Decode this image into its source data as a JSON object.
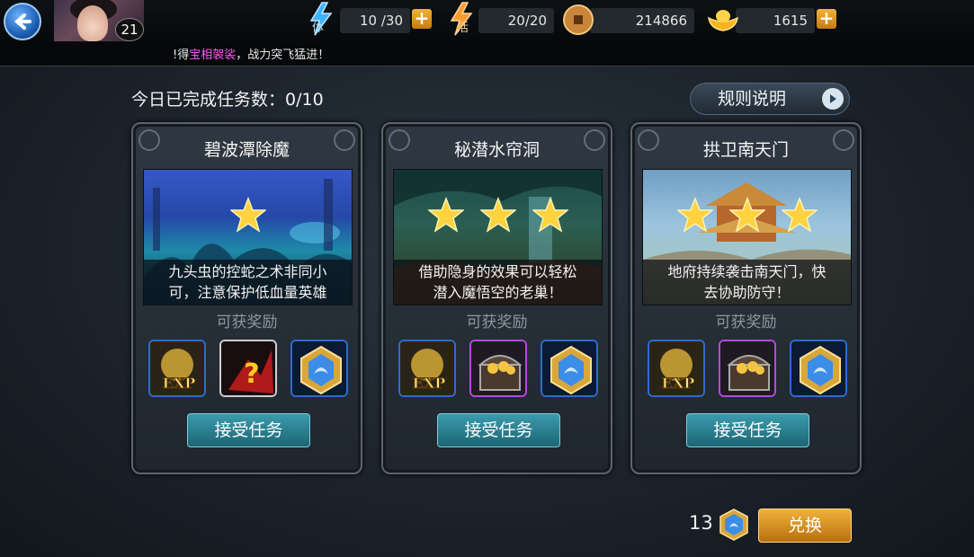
{
  "header": {
    "level": "21",
    "stamina": {
      "label": "体",
      "value": "10 /30"
    },
    "vigor": {
      "label": "活",
      "value": "20/20"
    },
    "coins": "214866",
    "gold": "1615",
    "plus_label": "+"
  },
  "ticker": {
    "prefix": "!得",
    "highlight": "宝相袈裟",
    "suffix": "，战力突飞猛进！"
  },
  "task_count": "今日已完成任务数：0/10",
  "rules_button": "规则说明",
  "reward_label": "可获奖励",
  "accept_label": "接受任务",
  "cards": [
    {
      "title": "碧波潭除魔",
      "stars": 1,
      "desc_line1": "九头虫的控蛇之术非同小",
      "desc_line2": "可，注意保护低血量英雄",
      "exp_label": "EXP",
      "mystery_label": "?"
    },
    {
      "title": "秘潜水帘洞",
      "stars": 3,
      "desc_line1": "借助隐身的效果可以轻松",
      "desc_line2": "潜入魔悟空的老巢！",
      "exp_label": "EXP"
    },
    {
      "title": "拱卫南天门",
      "stars": 3,
      "desc_line1": "地府持续袭击南天门，快",
      "desc_line2": "去协助防守！",
      "exp_label": "EXP"
    }
  ],
  "footer": {
    "gem_count": "13",
    "exchange_label": "兑换"
  }
}
